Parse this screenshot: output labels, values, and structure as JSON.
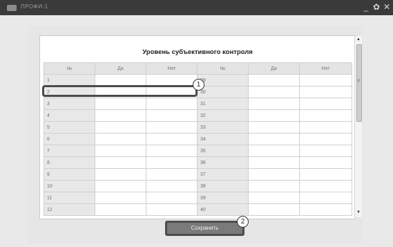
{
  "window": {
    "title": "ПРОФИ-1",
    "controls": [
      "_",
      "✿",
      "✕"
    ]
  },
  "table": {
    "title": "Уровень субъективного контроля",
    "headers": [
      "№",
      "Да",
      "Нет",
      "№",
      "Да",
      "Нет"
    ],
    "rows": [
      [
        "1",
        "29"
      ],
      [
        "2",
        "30"
      ],
      [
        "3",
        "31"
      ],
      [
        "4",
        "32"
      ],
      [
        "5",
        "33"
      ],
      [
        "6",
        "34"
      ],
      [
        "7",
        "35"
      ],
      [
        "8",
        "36"
      ],
      [
        "9",
        "37"
      ],
      [
        "10",
        "38"
      ],
      [
        "11",
        "39"
      ],
      [
        "12",
        "40"
      ]
    ]
  },
  "callouts": {
    "first": "1",
    "second": "2"
  },
  "save_button": {
    "label": "Сохранить"
  }
}
